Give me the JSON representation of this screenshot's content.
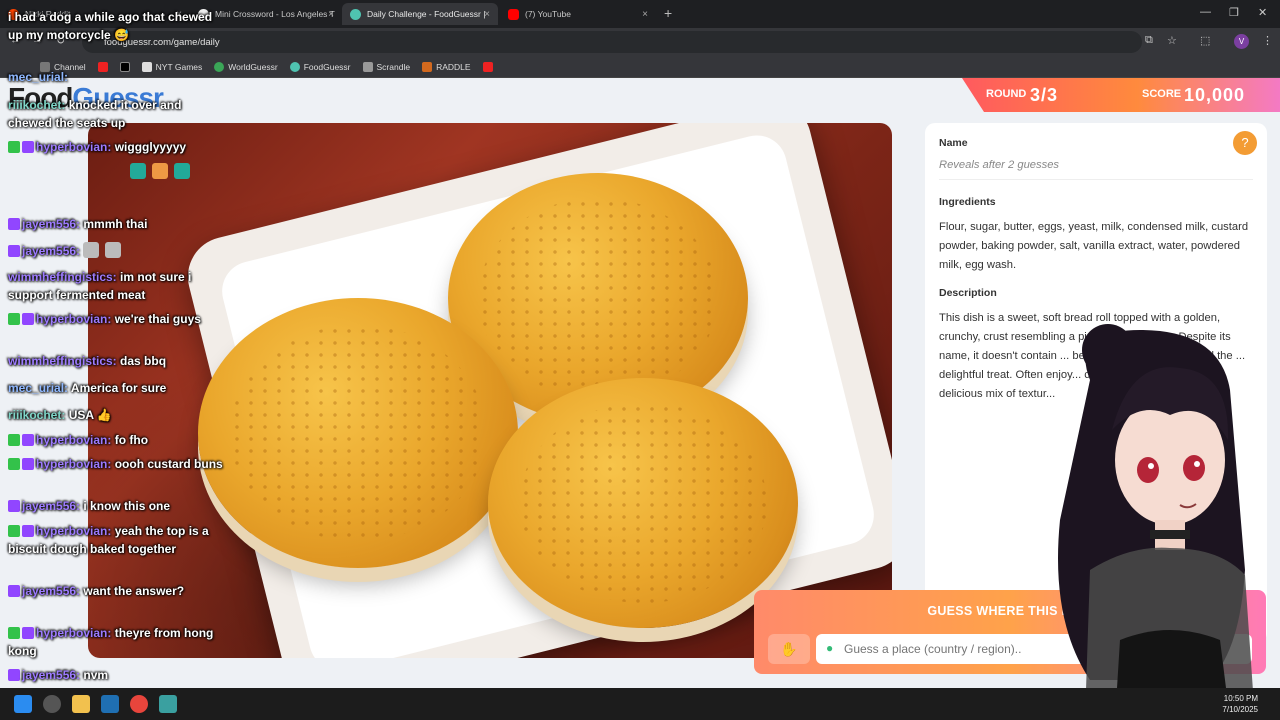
{
  "browser": {
    "tabs": [
      {
        "label": "Nikki Reddit",
        "close": "×"
      },
      {
        "label": "Mini Crossword - Los Angeles T",
        "close": "×"
      },
      {
        "label": "Daily Challenge - FoodGuessr |",
        "close": "×"
      },
      {
        "label": "(7) YouTube",
        "close": "×"
      }
    ],
    "new_tab": "+",
    "url": "foodguessr.com/game/daily",
    "bookmarks": [
      "Channel",
      "NYT Games",
      "WorldGuessr",
      "FoodGuessr",
      "Scrandle",
      "RADDLE"
    ],
    "profile_initial": "V",
    "colors": {
      "chrome_bg": "#35363a",
      "tab_bg": "#1e1f22"
    }
  },
  "page": {
    "brand_part1": "Food",
    "brand_part2": "Guessr",
    "round_label": "ROUND",
    "round_value": "3/3",
    "score_label": "SCORE",
    "score_value": "10,000",
    "name_label": "Name",
    "name_value": "Reveals after 2 guesses",
    "ingredients_label": "Ingredients",
    "ingredients_text": "Flour, sugar, butter, eggs, yeast, milk, condensed milk, custard powder, baking powder, salt, vanilla extract, water, powdered milk, egg wash.",
    "description_label": "Description",
    "description_text": "This dish is a sweet, soft bread roll topped with a golden, crunchy, crust resembling a pineapple's pattern. Despite its name, it doesn't contain ... between the fluffy inside and the ... delightful treat. Often enjoy... can be served plain or w... a delicious mix of textur...",
    "guess_title": "GUESS WHERE THIS DISH",
    "guess_placeholder": "Guess a place (country / region)..",
    "help_icon": "?"
  },
  "chat": [
    {
      "text": "i had a dog a while ago that chewed up my motorcycle 😅",
      "user": ""
    },
    {
      "user": "mec_urial:",
      "text": ""
    },
    {
      "user": "riiikochet:",
      "text": "knocked it over and chewed the seats up"
    },
    {
      "user": "hyperbovian:",
      "text": "wiggglyyyyy"
    },
    {
      "user": "jayem556:",
      "text": "mmmh thai"
    },
    {
      "user": "jayem556:",
      "text": ""
    },
    {
      "user": "wimmheffingistics:",
      "text": "im not sure i support fermented meat"
    },
    {
      "user": "hyperbovian:",
      "text": "we're thai guys"
    },
    {
      "user": "wimmheffingistics:",
      "text": "das bbq"
    },
    {
      "user": "mec_urial:",
      "text": "America for sure"
    },
    {
      "user": "riiikochet:",
      "text": "USA 👍"
    },
    {
      "user": "hyperbovian:",
      "text": "fo fho"
    },
    {
      "user": "hyperbovian:",
      "text": "oooh custard buns"
    },
    {
      "user": "jayem556:",
      "text": "i know this one"
    },
    {
      "user": "hyperbovian:",
      "text": "yeah the top is a biscuit dough baked together"
    },
    {
      "user": "jayem556:",
      "text": "want the answer?"
    },
    {
      "user": "hyperbovian:",
      "text": "theyre from hong kong"
    },
    {
      "user": "jayem556:",
      "text": "nvm"
    }
  ],
  "taskbar": {
    "time": "10:50 PM",
    "date": "7/10/2025"
  }
}
